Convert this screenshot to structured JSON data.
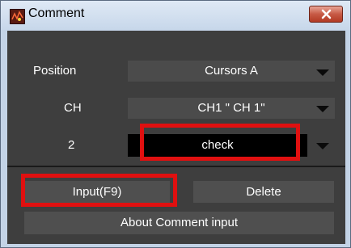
{
  "window": {
    "title": "Comment"
  },
  "form": {
    "position_label": "Position",
    "position_value": "Cursors A",
    "ch_label": "CH",
    "ch_value": "CH1  \" CH 1\"",
    "number_label": "2",
    "comment_value": "check"
  },
  "buttons": {
    "input": "Input(F9)",
    "delete": "Delete",
    "about": "About Comment input"
  },
  "colors": {
    "highlight": "#e01010",
    "panel": "#3e3e3e"
  }
}
